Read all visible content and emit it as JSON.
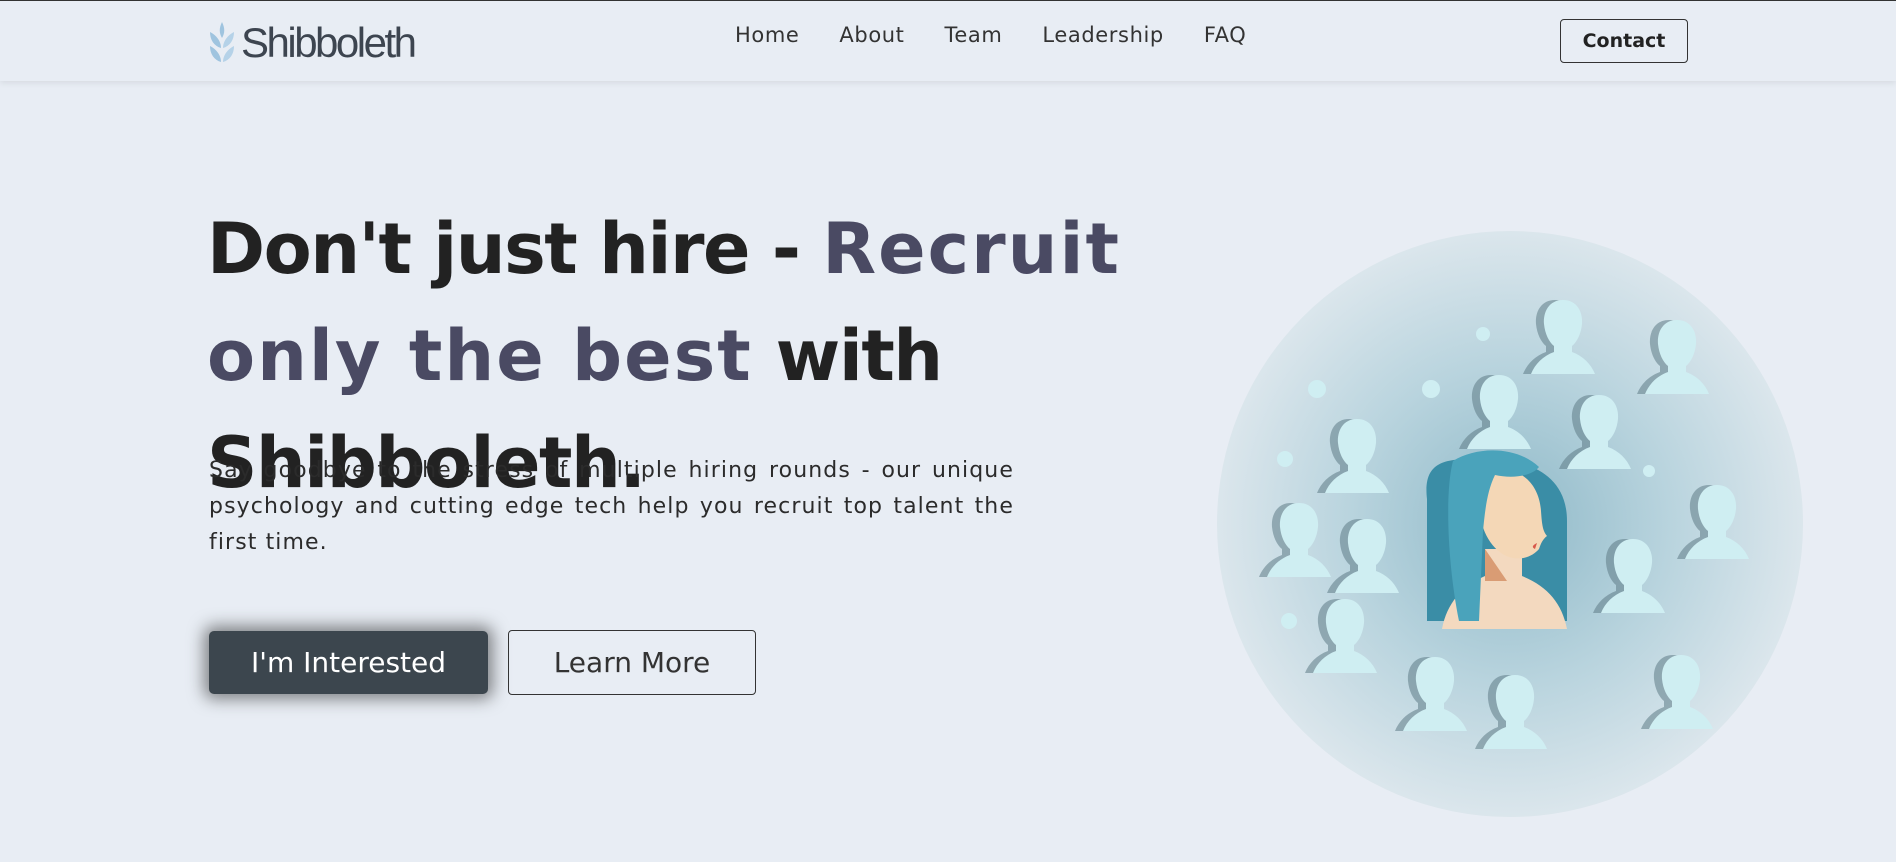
{
  "brand": {
    "name": "Shibboleth",
    "logo_icon": "wheat-icon",
    "accent_color": "#4a4a63",
    "dark_button_color": "#3c464e",
    "background_color": "#e8edf4"
  },
  "nav": {
    "items": [
      "Home",
      "About",
      "Team",
      "Leadership",
      "FAQ"
    ],
    "contact_label": "Contact"
  },
  "hero": {
    "headline_part1": "Don't just hire - ",
    "headline_accent": "Recruit  only the  best",
    "headline_part2": " with Shibboleth.",
    "description": "Say goodbye to the stress of multiple hiring rounds - our unique psychology and cutting edge tech help you recruit top talent the first time.",
    "primary_cta": "I'm Interested",
    "secondary_cta": "Learn More",
    "illustration": "crowd-of-head-silhouettes-with-highlighted-woman-illustration"
  }
}
